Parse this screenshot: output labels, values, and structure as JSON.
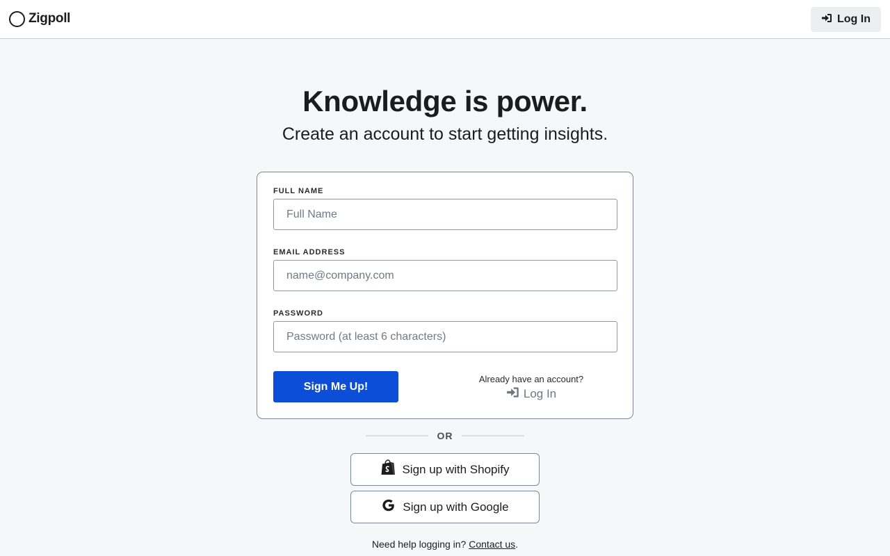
{
  "header": {
    "brand": "Zigpoll",
    "login_label": "Log In"
  },
  "hero": {
    "title": "Knowledge is power.",
    "subtitle": "Create an account to start getting insights."
  },
  "form": {
    "full_name": {
      "label": "FULL NAME",
      "placeholder": "Full Name",
      "value": ""
    },
    "email": {
      "label": "EMAIL ADDRESS",
      "placeholder": "name@company.com",
      "value": ""
    },
    "password": {
      "label": "PASSWORD",
      "placeholder": "Password (at least 6 characters)",
      "value": ""
    },
    "submit_label": "Sign Me Up!",
    "already_text": "Already have an account?",
    "login_label": "Log In"
  },
  "divider": {
    "text": "OR"
  },
  "social": {
    "shopify_label": "Sign up with Shopify",
    "google_label": "Sign up with Google"
  },
  "footer": {
    "help_text": "Need help logging in?",
    "contact_label": "Contact us",
    "end_punct": "."
  },
  "colors": {
    "primary": "#0d4ed8",
    "background": "#f5f7f9",
    "text": "#1c1c1c",
    "muted": "#6d7781"
  },
  "icons": {
    "brand": "circle-logo-icon",
    "login": "sign-in-arrow-icon",
    "shopify": "shopify-bag-icon",
    "google": "google-g-icon"
  }
}
